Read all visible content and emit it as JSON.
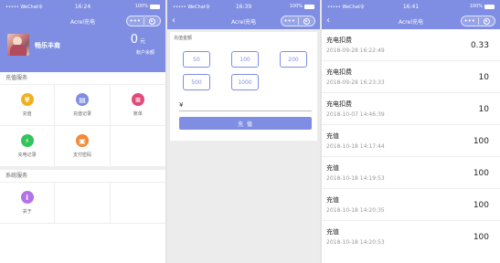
{
  "statusbar": {
    "carrier": "••••• WeChat令",
    "battery_pct": "100%"
  },
  "screen1": {
    "time": "16:24",
    "title": "Acrel充电",
    "user": {
      "name": "畅乐丰商"
    },
    "balance": {
      "amount": "0",
      "unit": "元",
      "label": "账户余额"
    },
    "section_recharge": "充值服务",
    "grid1": [
      {
        "label": "充值",
        "icon": "money-bag-icon",
        "color": "#f2b01e",
        "glyph": "¥"
      },
      {
        "label": "充值记录",
        "icon": "document-icon",
        "color": "#7f8ee3",
        "glyph": "▤"
      },
      {
        "label": "账单",
        "icon": "bill-icon",
        "color": "#e24a7a",
        "glyph": "≡"
      },
      {
        "label": "充电记录",
        "icon": "lightning-icon",
        "color": "#2fc65a",
        "glyph": "⚡"
      },
      {
        "label": "支付密码",
        "icon": "lock-icon",
        "color": "#f38a3a",
        "glyph": "▣"
      },
      {
        "label": "",
        "icon": "",
        "color": "",
        "glyph": ""
      }
    ],
    "section_system": "系统服务",
    "grid2": [
      {
        "label": "关于",
        "icon": "info-icon",
        "color": "#b472e8",
        "glyph": "i"
      },
      {
        "label": "",
        "icon": "",
        "color": "",
        "glyph": ""
      },
      {
        "label": "",
        "icon": "",
        "color": "",
        "glyph": ""
      }
    ]
  },
  "screen2": {
    "time": "16:39",
    "title": "Acrel充电",
    "amount_label": "充值金额",
    "amounts": [
      "50",
      "100",
      "200",
      "500",
      "1000"
    ],
    "currency": "¥",
    "button": "充 值"
  },
  "screen3": {
    "time": "16:41",
    "title": "Acrel充电",
    "records": [
      {
        "type": "充电扣费",
        "time": "2018-09-28 16:22:49",
        "amount": "0.33"
      },
      {
        "type": "充电扣费",
        "time": "2018-09-28 16:23:33",
        "amount": "10"
      },
      {
        "type": "充电扣费",
        "time": "2018-10-07 14:46:39",
        "amount": "10"
      },
      {
        "type": "充值",
        "time": "2018-10-18 14:17:44",
        "amount": "100"
      },
      {
        "type": "充值",
        "time": "2018-10-18 14:19:53",
        "amount": "100"
      },
      {
        "type": "充值",
        "time": "2018-10-18 14:20:35",
        "amount": "100"
      },
      {
        "type": "充值",
        "time": "2018-10-18 14:20:53",
        "amount": "100"
      }
    ]
  }
}
